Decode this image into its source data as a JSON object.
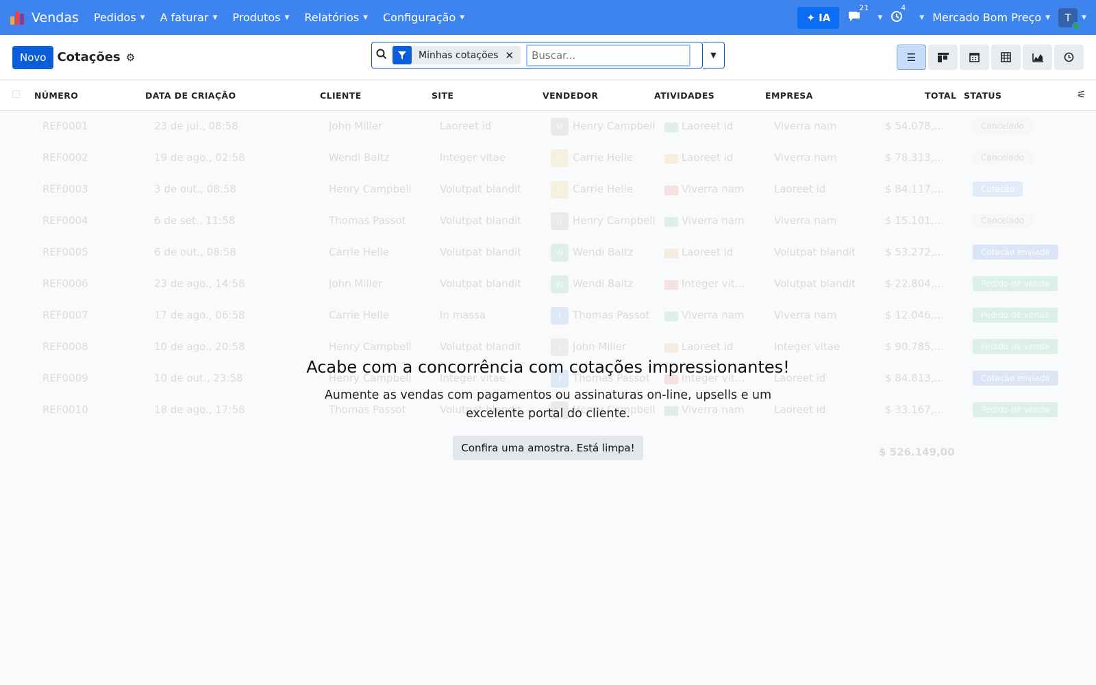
{
  "nav": {
    "app_name": "Vendas",
    "menus": [
      "Pedidos",
      "A faturar",
      "Produtos",
      "Relatórios",
      "Configuração"
    ],
    "ia_label": "✦ IA",
    "messages_count": "21",
    "activities_count": "4",
    "company": "Mercado Bom Preço",
    "user_initial": "T"
  },
  "control": {
    "new_label": "Novo",
    "title": "Cotações",
    "facet_label": "Minhas cotações",
    "search_placeholder": "Buscar..."
  },
  "table": {
    "headers": [
      "NÚMERO",
      "DATA DE CRIAÇÃO",
      "CLIENTE",
      "SITE",
      "VENDEDOR",
      "ATIVIDADES",
      "EMPRESA",
      "TOTAL",
      "STATUS"
    ],
    "rows": [
      {
        "number": "REF0001",
        "date": "23 de jul., 08:58",
        "client": "John Miller",
        "site": "Laoreet id",
        "seller": "Henry Campbell",
        "seller_initial": "H",
        "activity": "Laoreet id",
        "company": "Viverra nam",
        "total": "$ 54.078,...",
        "status": "Cancelado"
      },
      {
        "number": "REF0002",
        "date": "19 de ago., 02:58",
        "client": "Wendi Baltz",
        "site": "Integer vitae",
        "seller": "Carrie Helle",
        "seller_initial": "C",
        "activity": "Laoreet id",
        "company": "Viverra nam",
        "total": "$ 78.313,...",
        "status": "Cancelado"
      },
      {
        "number": "REF0003",
        "date": "3 de out., 08:58",
        "client": "Henry Campbell",
        "site": "Volutpat blandit",
        "seller": "Carrie Helle",
        "seller_initial": "C",
        "activity": "Viverra nam",
        "company": "Laoreet id",
        "total": "$ 84.117,...",
        "status": "Cotação"
      },
      {
        "number": "REF0004",
        "date": "6 de set., 11:58",
        "client": "Thomas Passot",
        "site": "Volutpat blandit",
        "seller": "Henry Campbell",
        "seller_initial": "H",
        "activity": "Viverra nam",
        "company": "Viverra nam",
        "total": "$ 15.101,...",
        "status": "Cancelado"
      },
      {
        "number": "REF0005",
        "date": "6 de out., 08:58",
        "client": "Carrie Helle",
        "site": "Volutpat blandit",
        "seller": "Wendi Baltz",
        "seller_initial": "W",
        "activity": "Laoreet id",
        "company": "Volutpat blandit",
        "total": "$ 53.272,...",
        "status": "Cotação enviada"
      },
      {
        "number": "REF0006",
        "date": "23 de ago., 14:58",
        "client": "John Miller",
        "site": "Volutpat blandit",
        "seller": "Wendi Baltz",
        "seller_initial": "W",
        "activity": "Integer vit...",
        "company": "Volutpat blandit",
        "total": "$ 22.804,...",
        "status": "Pedido de venda"
      },
      {
        "number": "REF0007",
        "date": "17 de ago., 06:58",
        "client": "Carrie Helle",
        "site": "In massa",
        "seller": "Thomas Passot",
        "seller_initial": "T",
        "activity": "Viverra nam",
        "company": "Viverra nam",
        "total": "$ 12.046,...",
        "status": "Pedido de venda"
      },
      {
        "number": "REF0008",
        "date": "10 de ago., 20:58",
        "client": "Henry Campbell",
        "site": "Volutpat blandit",
        "seller": "John Miller",
        "seller_initial": "J",
        "activity": "Laoreet id",
        "company": "Integer vitae",
        "total": "$ 90.785,...",
        "status": "Pedido de venda"
      },
      {
        "number": "REF0009",
        "date": "10 de out., 23:58",
        "client": "Henry Campbell",
        "site": "Integer vitae",
        "seller": "Thomas Passot",
        "seller_initial": "T",
        "activity": "Integer vit...",
        "company": "Laoreet id",
        "total": "$ 84.813,...",
        "status": "Cotação enviada"
      },
      {
        "number": "REF0010",
        "date": "18 de ago., 17:58",
        "client": "Thomas Passot",
        "site": "Volutpat blandit",
        "seller": "Henry Campbell",
        "seller_initial": "H",
        "activity": "Viverra nam",
        "company": "Laoreet id",
        "total": "$ 33.167,...",
        "status": "Pedido de venda"
      }
    ],
    "sum_total": "$ 526.149,00"
  },
  "helper": {
    "title": "Acabe com a concorrência com cotações impressionantes!",
    "description": "Aumente as vendas com pagamentos ou assinaturas on-line, upsells e um excelente portal do cliente.",
    "button": "Confira uma amostra. Está limpa!"
  },
  "colors": {
    "navbar": "#3e84ee",
    "primary": "#0b5ed7",
    "status_cancelled": "#e9ecef",
    "status_quote": "#5b9cf4",
    "status_sent": "#2f6fdb",
    "status_order": "#2bb673"
  }
}
